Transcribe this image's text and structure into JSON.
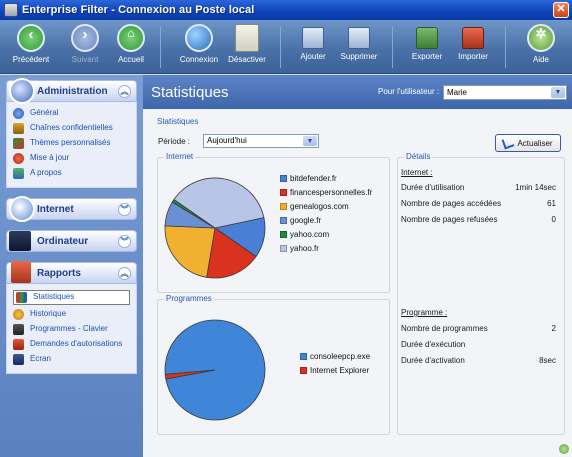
{
  "window": {
    "title": "Enterprise Filter - Connexion au Poste local"
  },
  "toolbar": {
    "back": "Précédent",
    "forward": "Suivant",
    "home": "Accueil",
    "connect": "Connexion",
    "disable": "Désactiver",
    "add": "Ajouter",
    "remove": "Supprimer",
    "export": "Exporter",
    "import": "Importer",
    "help": "Aide"
  },
  "sidebar": {
    "administration": {
      "label": "Administration",
      "items": [
        "Général",
        "Chaînes confidentielles",
        "Thèmes personnalisés",
        "Mise à jour",
        "A propos"
      ]
    },
    "internet": {
      "label": "Internet"
    },
    "ordinateur": {
      "label": "Ordinateur"
    },
    "rapports": {
      "label": "Rapports",
      "items": [
        "Statistiques",
        "Historique",
        "Programmes - Clavier",
        "Demandes d'autorisations",
        "Ecran"
      ]
    }
  },
  "main": {
    "title": "Statistiques",
    "user_label": "Pour l'utilisateur :",
    "user_value": "Marie",
    "stats_legend": "Statistiques",
    "period_label": "Période :",
    "period_value": "Aujourd'hui",
    "refresh": "Actualiser",
    "internet_legend": "Internet",
    "programs_legend": "Programmes",
    "details_legend": "Détails"
  },
  "details": {
    "internet_head": "Internet :",
    "internet_rows": [
      {
        "label": "Durée d'utilisation",
        "value": "1min 14sec"
      },
      {
        "label": "Nombre de pages accédées",
        "value": "61"
      },
      {
        "label": "Nombre de pages refusées",
        "value": "0"
      }
    ],
    "program_head": "Programme :",
    "program_rows": [
      {
        "label": "Nombre de programmes",
        "value": "2"
      },
      {
        "label": "Durée d'exécution",
        "value": ""
      },
      {
        "label": "Durée d'activation",
        "value": "8sec"
      }
    ]
  },
  "chart_data": [
    {
      "type": "pie",
      "title": "Internet",
      "categories": [
        "bitdefender.fr",
        "financespersonnelles.fr",
        "genealogos.com",
        "google.fr",
        "yahoo.com",
        "yahoo.fr"
      ],
      "values": [
        13,
        18,
        23,
        8,
        1,
        37
      ],
      "colors": [
        "#4a7fd6",
        "#d9321f",
        "#f2b030",
        "#6a8fd4",
        "#1f8a3a",
        "#b9c5e6"
      ]
    },
    {
      "type": "pie",
      "title": "Programmes",
      "categories": [
        "consoleepcp.exe",
        "Internet Explorer"
      ],
      "values": [
        98.5,
        1.5
      ],
      "colors": [
        "#3f86d8",
        "#d9321f"
      ]
    }
  ]
}
